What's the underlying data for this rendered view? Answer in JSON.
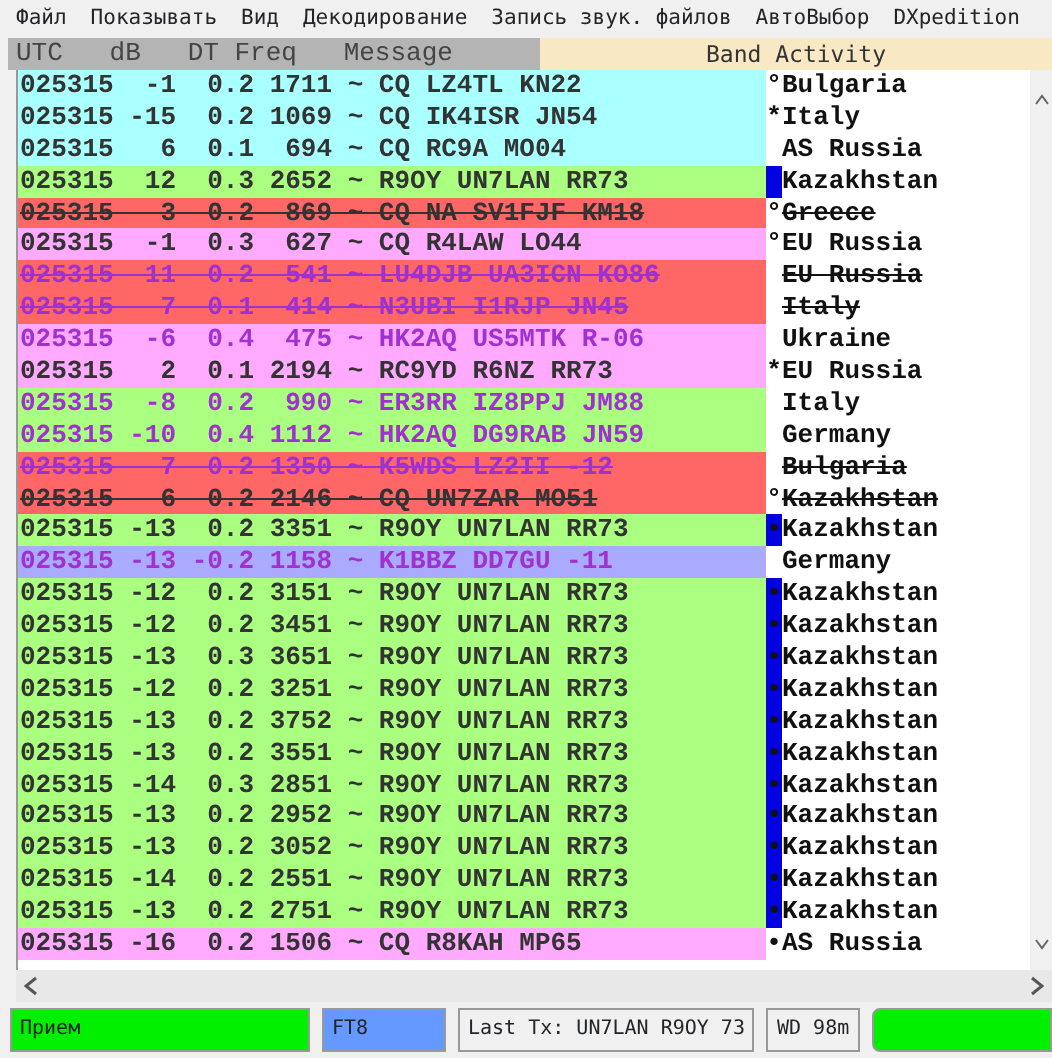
{
  "menu": [
    "Файл",
    "Показывать",
    "Вид",
    "Декодирование",
    "Запись звук. файлов",
    "АвтоВыбор",
    "DXpedition"
  ],
  "header": {
    "columns": [
      "UTC",
      "dB",
      "DT",
      "Freq",
      "Message"
    ],
    "title": "Band Activity"
  },
  "rows": [
    {
      "line": "025315  -1  0.2 1711 ~ CQ LZ4TL KN22",
      "mark": "°",
      "country": "Bulgaria",
      "color": "#aaffff",
      "kind": "plain",
      "struck": false,
      "flagged": false
    },
    {
      "line": "025315 -15  0.2 1069 ~ CQ IK4ISR JN54",
      "mark": "*",
      "country": "Italy",
      "color": "#aaffff",
      "kind": "plain",
      "struck": false,
      "flagged": false
    },
    {
      "line": "025315   6  0.1  694 ~ CQ RC9A MO04",
      "country": "AS Russia",
      "color": "#aaffff",
      "kind": "plain",
      "struck": false,
      "flagged": false
    },
    {
      "line": "025315  12  0.3 2652 ~ R9OY UN7LAN RR73",
      "country": "Kazakhstan",
      "color": "#aaff80",
      "kind": "plain",
      "struck": false,
      "flagged": true
    },
    {
      "line": "025315   3  0.2  869 ~ CQ NA SV1FJF KM18",
      "mark": "°",
      "country": "Greece",
      "color": "#ff6666",
      "kind": "plain",
      "struck": true,
      "flagged": false
    },
    {
      "line": "025315  -1  0.3  627 ~ CQ R4LAW LO44",
      "mark": "°",
      "country": "EU Russia",
      "color": "#ffaaff",
      "kind": "plain",
      "struck": false,
      "flagged": false
    },
    {
      "line": "025315  11  0.2  541 ~ LU4DJB UA3ICN KO86",
      "country": "EU Russia",
      "color": "#ff6666",
      "kind": "tx",
      "struck": true,
      "flagged": false
    },
    {
      "line": "025315   7  0.1  414 ~ N3UBI I1RJP JN45",
      "country": "Italy",
      "color": "#ff6666",
      "kind": "tx",
      "struck": true,
      "flagged": false
    },
    {
      "line": "025315  -6  0.4  475 ~ HK2AQ US5MTK R-06",
      "country": "Ukraine",
      "color": "#ffaaff",
      "kind": "tx",
      "struck": false,
      "flagged": false
    },
    {
      "line": "025315   2  0.1 2194 ~ RC9YD R6NZ RR73",
      "mark": "*",
      "country": "EU Russia",
      "color": "#ffaaff",
      "kind": "plain",
      "struck": false,
      "flagged": false
    },
    {
      "line": "025315  -8  0.2  990 ~ ER3RR IZ8PPJ JM88",
      "country": "Italy",
      "color": "#aaff80",
      "kind": "tx",
      "struck": false,
      "flagged": false
    },
    {
      "line": "025315 -10  0.4 1112 ~ HK2AQ DG9RAB JN59",
      "country": "Germany",
      "color": "#aaff80",
      "kind": "tx",
      "struck": false,
      "flagged": false
    },
    {
      "line": "025315   7  0.2 1350 ~ K5WDS LZ2II -12",
      "country": "Bulgaria",
      "color": "#ff6666",
      "kind": "tx",
      "struck": true,
      "flagged": false
    },
    {
      "line": "025315   6  0.2 2146 ~ CQ UN7ZAR MO51",
      "mark": "°",
      "country": "Kazakhstan",
      "color": "#ff6666",
      "kind": "plain",
      "struck": true,
      "flagged": false
    },
    {
      "line": "025315 -13  0.2 3351 ~ R9OY UN7LAN RR73",
      "mark": "•",
      "country": "Kazakhstan",
      "color": "#aaff80",
      "kind": "plain",
      "struck": false,
      "flagged": true
    },
    {
      "line": "025315 -13 -0.2 1158 ~ K1BBZ DD7GU -11",
      "country": "Germany",
      "color": "#aaaaff",
      "kind": "tx",
      "struck": false,
      "flagged": false
    },
    {
      "line": "025315 -12  0.2 3151 ~ R9OY UN7LAN RR73",
      "mark": "•",
      "country": "Kazakhstan",
      "color": "#aaff80",
      "kind": "plain",
      "struck": false,
      "flagged": true
    },
    {
      "line": "025315 -12  0.2 3451 ~ R9OY UN7LAN RR73",
      "mark": "•",
      "country": "Kazakhstan",
      "color": "#aaff80",
      "kind": "plain",
      "struck": false,
      "flagged": true
    },
    {
      "line": "025315 -13  0.3 3651 ~ R9OY UN7LAN RR73",
      "mark": "•",
      "country": "Kazakhstan",
      "color": "#aaff80",
      "kind": "plain",
      "struck": false,
      "flagged": true
    },
    {
      "line": "025315 -12  0.2 3251 ~ R9OY UN7LAN RR73",
      "mark": "•",
      "country": "Kazakhstan",
      "color": "#aaff80",
      "kind": "plain",
      "struck": false,
      "flagged": true
    },
    {
      "line": "025315 -13  0.2 3752 ~ R9OY UN7LAN RR73",
      "mark": "•",
      "country": "Kazakhstan",
      "color": "#aaff80",
      "kind": "plain",
      "struck": false,
      "flagged": true
    },
    {
      "line": "025315 -13  0.2 3551 ~ R9OY UN7LAN RR73",
      "mark": "•",
      "country": "Kazakhstan",
      "color": "#aaff80",
      "kind": "plain",
      "struck": false,
      "flagged": true
    },
    {
      "line": "025315 -14  0.3 2851 ~ R9OY UN7LAN RR73",
      "mark": "•",
      "country": "Kazakhstan",
      "color": "#aaff80",
      "kind": "plain",
      "struck": false,
      "flagged": true
    },
    {
      "line": "025315 -13  0.2 2952 ~ R9OY UN7LAN RR73",
      "mark": "•",
      "country": "Kazakhstan",
      "color": "#aaff80",
      "kind": "plain",
      "struck": false,
      "flagged": true
    },
    {
      "line": "025315 -13  0.2 3052 ~ R9OY UN7LAN RR73",
      "mark": "•",
      "country": "Kazakhstan",
      "color": "#aaff80",
      "kind": "plain",
      "struck": false,
      "flagged": true
    },
    {
      "line": "025315 -14  0.2 2551 ~ R9OY UN7LAN RR73",
      "mark": "•",
      "country": "Kazakhstan",
      "color": "#aaff80",
      "kind": "plain",
      "struck": false,
      "flagged": true
    },
    {
      "line": "025315 -13  0.2 2751 ~ R9OY UN7LAN RR73",
      "mark": "•",
      "country": "Kazakhstan",
      "color": "#aaff80",
      "kind": "plain",
      "struck": false,
      "flagged": true
    },
    {
      "line": "025315 -16  0.2 1506 ~ CQ R8KAH MP65",
      "mark": "•",
      "country": "AS Russia",
      "color": "#ffaaff",
      "kind": "plain",
      "struck": false,
      "flagged": false
    }
  ],
  "status_bar": {
    "state": "Прием",
    "mode": "FT8",
    "last_tx": "Last Tx: UN7LAN R9OY 73",
    "wd": "WD 98m"
  }
}
